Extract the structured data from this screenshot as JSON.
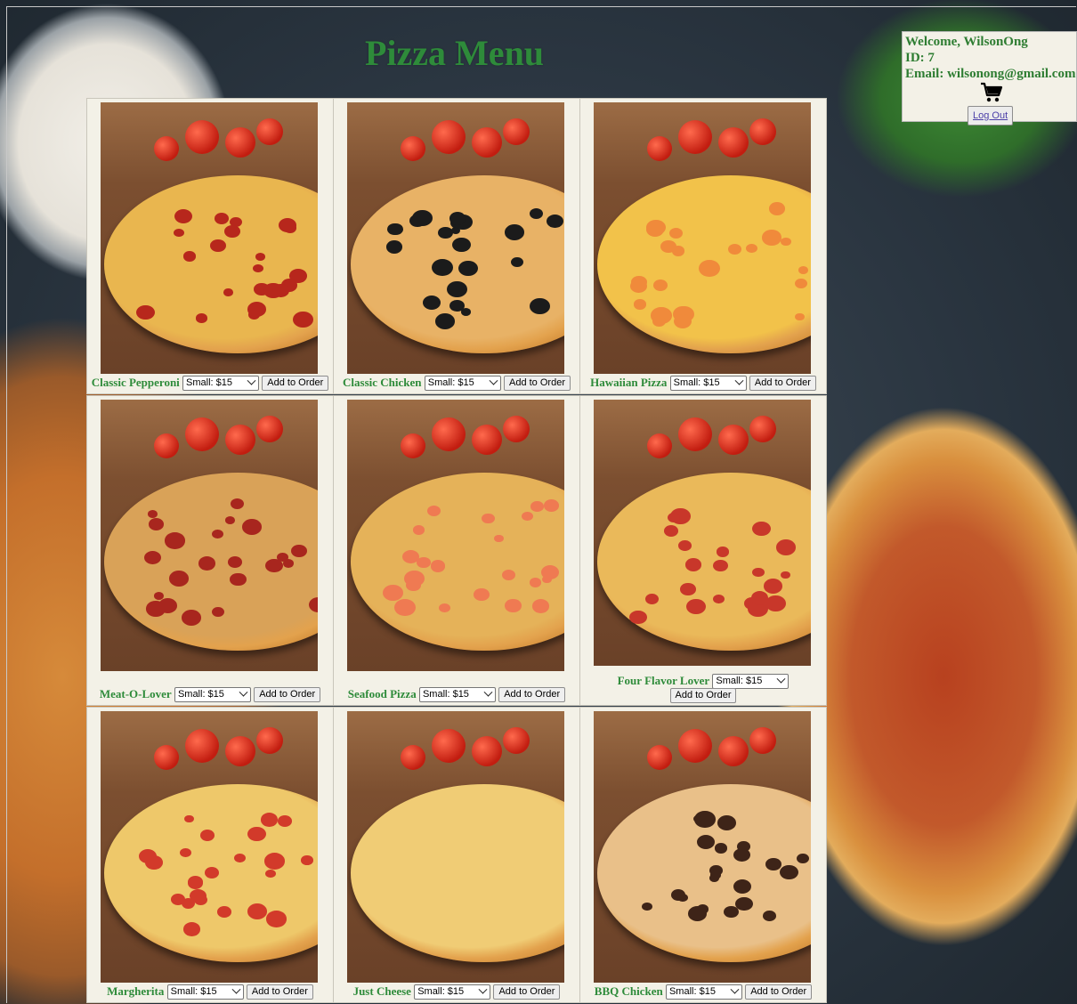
{
  "page": {
    "title": "Pizza Menu"
  },
  "user": {
    "welcome": "Welcome, WilsonOng",
    "id": "ID: 7",
    "email": "Email: wilsonong@gmail.com",
    "logout_label": "Log Out",
    "cart_icon": "shopping-cart-icon"
  },
  "menu": {
    "size_selected": "Small: $15",
    "add_label": "Add to Order",
    "items": [
      {
        "name": "Classic Pepperoni",
        "topping_color": "#e9b64f",
        "topping_accent": "#b7271c"
      },
      {
        "name": "Classic Chicken",
        "topping_color": "#e8b266",
        "topping_accent": "#1b1b1b"
      },
      {
        "name": "Hawaiian Pizza",
        "topping_color": "#f2c24a",
        "topping_accent": "#f08a3b"
      },
      {
        "name": "Meat-O-Lover",
        "topping_color": "#d9a258",
        "topping_accent": "#a8261e"
      },
      {
        "name": "Seafood Pizza",
        "topping_color": "#e5b259",
        "topping_accent": "#ef7a52"
      },
      {
        "name": "Four Flavor Lover",
        "topping_color": "#eab95a",
        "topping_accent": "#c8372a"
      },
      {
        "name": "Margherita",
        "topping_color": "#eec86a",
        "topping_accent": "#d23a2a"
      },
      {
        "name": "Just Cheese",
        "topping_color": "#f0cc75",
        "topping_accent": "#f0cc75"
      },
      {
        "name": "BBQ Chicken",
        "topping_color": "#e9c089",
        "topping_accent": "#3e2418"
      }
    ]
  }
}
